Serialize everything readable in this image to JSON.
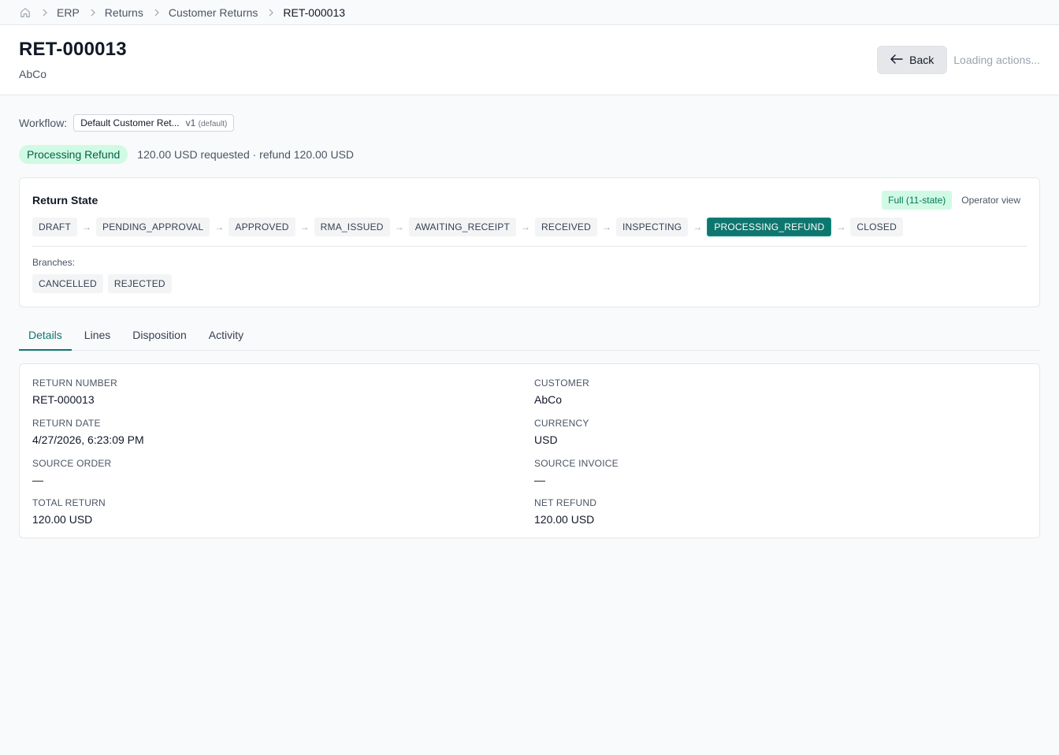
{
  "breadcrumb": {
    "items": [
      "ERP",
      "Returns",
      "Customer Returns",
      "RET-000013"
    ]
  },
  "header": {
    "title": "RET-000013",
    "subtitle": "AbCo",
    "back_label": "Back",
    "loading_label": "Loading actions..."
  },
  "workflow": {
    "label": "Workflow:",
    "name": "Default Customer Ret...",
    "version": "v1",
    "version_note": "(default)"
  },
  "status": {
    "pill": "Processing Refund",
    "summary": "120.00 USD requested · refund 120.00 USD"
  },
  "return_state": {
    "title": "Return State",
    "mode_badge": "Full (11-state)",
    "view_label": "Operator view",
    "states": [
      "DRAFT",
      "PENDING_APPROVAL",
      "APPROVED",
      "RMA_ISSUED",
      "AWAITING_RECEIPT",
      "RECEIVED",
      "INSPECTING",
      "PROCESSING_REFUND",
      "CLOSED"
    ],
    "active_state": "PROCESSING_REFUND",
    "arrow": "→",
    "branches_label": "Branches:",
    "branches": [
      "CANCELLED",
      "REJECTED"
    ]
  },
  "tabs": [
    {
      "label": "Details",
      "active": true
    },
    {
      "label": "Lines",
      "active": false
    },
    {
      "label": "Disposition",
      "active": false
    },
    {
      "label": "Activity",
      "active": false
    }
  ],
  "details": {
    "return_number": {
      "label": "RETURN NUMBER",
      "value": "RET-000013"
    },
    "customer": {
      "label": "CUSTOMER",
      "value": "AbCo"
    },
    "return_date": {
      "label": "RETURN DATE",
      "value": "4/27/2026, 6:23:09 PM"
    },
    "currency": {
      "label": "CURRENCY",
      "value": "USD"
    },
    "source_order": {
      "label": "SOURCE ORDER",
      "value": "—"
    },
    "source_invoice": {
      "label": "SOURCE INVOICE",
      "value": "—"
    },
    "total_return": {
      "label": "TOTAL RETURN",
      "value": "120.00 USD"
    },
    "net_refund": {
      "label": "NET REFUND",
      "value": "120.00 USD"
    }
  },
  "colors": {
    "accent": "#0f766e",
    "status_bg": "#d1fae5",
    "status_fg": "#065f46"
  },
  "icons": {
    "home": "home-icon",
    "separator": "chevron-right-icon",
    "back": "arrow-left-icon"
  }
}
